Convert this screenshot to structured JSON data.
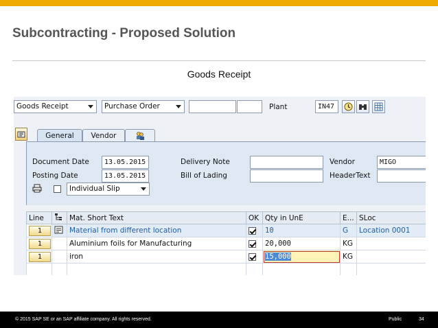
{
  "slide": {
    "title": "Subcontracting - Proposed Solution",
    "subtitle": "Goods Receipt"
  },
  "toolbar": {
    "transaction": "Goods Receipt",
    "reference": "Purchase Order",
    "plant_label": "Plant",
    "plant_value": "IN47"
  },
  "tabs": [
    {
      "label": "General",
      "active": true
    },
    {
      "label": "Vendor",
      "active": false
    }
  ],
  "header": {
    "document_date_label": "Document Date",
    "document_date": "13.05.2015",
    "posting_date_label": "Posting Date",
    "posting_date": "13.05.2015",
    "delivery_note_label": "Delivery Note",
    "bill_of_lading_label": "Bill of Lading",
    "vendor_label": "Vendor",
    "vendor_value": "MIGO",
    "header_text_label": "HeaderText",
    "slip_option": "Individual Slip"
  },
  "grid": {
    "columns": [
      "Line",
      "Mat. Short Text",
      "OK",
      "Qty in UnE",
      "E...",
      "SLoc"
    ],
    "rows": [
      {
        "line": "1",
        "text": "Material from different location",
        "qty": "10",
        "unit": "G",
        "sloc": "Location 0001"
      },
      {
        "line": "1",
        "text": "Aluminium foils for Manufacturing",
        "qty": "20,000",
        "unit": "KG",
        "sloc": ""
      },
      {
        "line": "1",
        "text": "iron",
        "qty": "15,000",
        "unit": "KG",
        "sloc": ""
      }
    ]
  },
  "footer": {
    "copyright": "© 2015 SAP SE or an SAP affiliate company. All rights reserved.",
    "classification": "Public",
    "page": "34"
  },
  "colors": {
    "accent": "#f0ab00",
    "footer_bg": "#000000",
    "link_blue": "#1d5ca8"
  }
}
